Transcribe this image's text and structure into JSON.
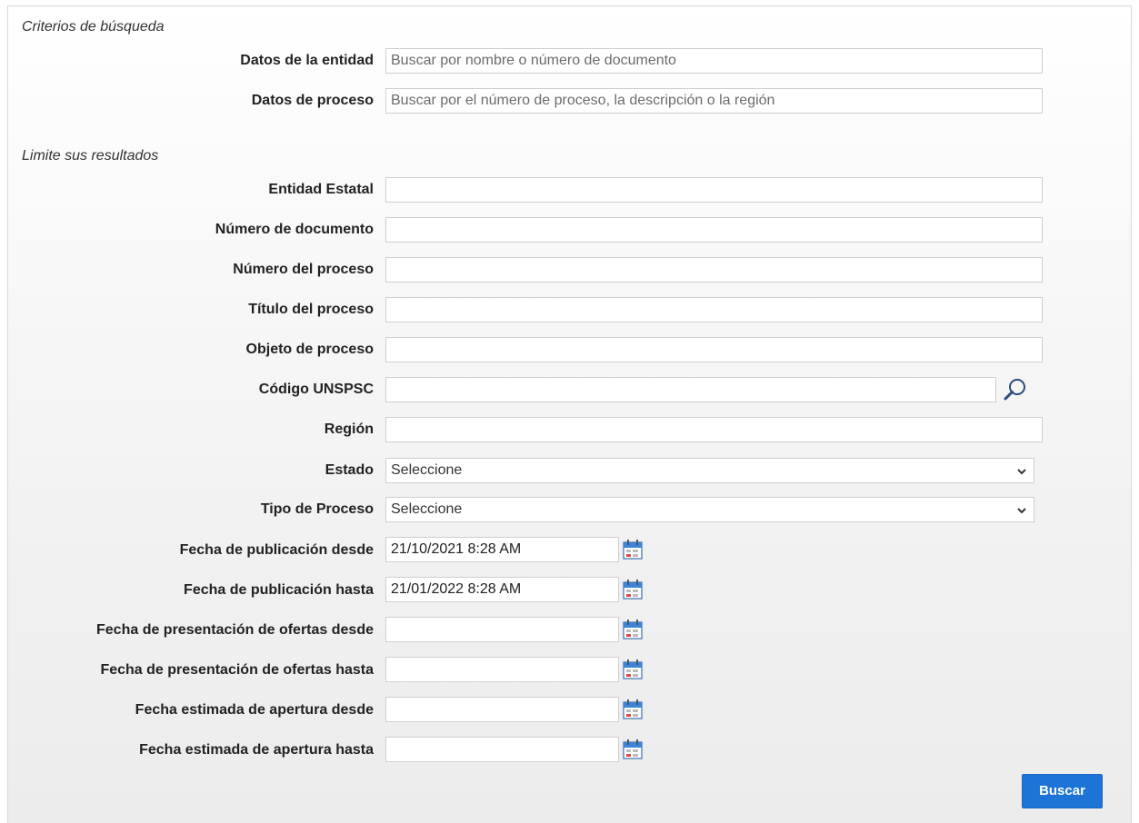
{
  "criterios": {
    "title": "Criterios de búsqueda",
    "entidad_label": "Datos de la entidad",
    "entidad_placeholder": "Buscar por nombre o número de documento",
    "proceso_label": "Datos de proceso",
    "proceso_placeholder": "Buscar por el número de proceso, la descripción o la región"
  },
  "limite": {
    "title": "Limite sus resultados",
    "entidad_estatal": {
      "label": "Entidad Estatal",
      "value": ""
    },
    "numero_documento": {
      "label": "Número de documento",
      "value": ""
    },
    "numero_proceso": {
      "label": "Número del proceso",
      "value": ""
    },
    "titulo_proceso": {
      "label": "Título del proceso",
      "value": ""
    },
    "objeto_proceso": {
      "label": "Objeto de proceso",
      "value": ""
    },
    "codigo_unspsc": {
      "label": "Código UNSPSC",
      "value": "",
      "icon": "search-icon"
    },
    "region": {
      "label": "Región",
      "value": ""
    },
    "estado": {
      "label": "Estado",
      "selected": "Seleccione"
    },
    "tipo_proceso": {
      "label": "Tipo de Proceso",
      "selected": "Seleccione"
    },
    "pub_desde": {
      "label": "Fecha de publicación desde",
      "value": "21/10/2021 8:28 AM",
      "icon": "calendar-icon"
    },
    "pub_hasta": {
      "label": "Fecha de publicación hasta",
      "value": "21/01/2022 8:28 AM",
      "icon": "calendar-icon"
    },
    "ofertas_desde": {
      "label": "Fecha de presentación de ofertas desde",
      "value": "",
      "icon": "calendar-icon"
    },
    "ofertas_hasta": {
      "label": "Fecha de presentación de ofertas hasta",
      "value": "",
      "icon": "calendar-icon"
    },
    "apertura_desde": {
      "label": "Fecha estimada de apertura desde",
      "value": "",
      "icon": "calendar-icon"
    },
    "apertura_hasta": {
      "label": "Fecha estimada de apertura hasta",
      "value": "",
      "icon": "calendar-icon"
    }
  },
  "actions": {
    "buscar_label": "Buscar"
  },
  "colors": {
    "primary_button": "#1e74d6",
    "border": "#cfcfcf"
  }
}
